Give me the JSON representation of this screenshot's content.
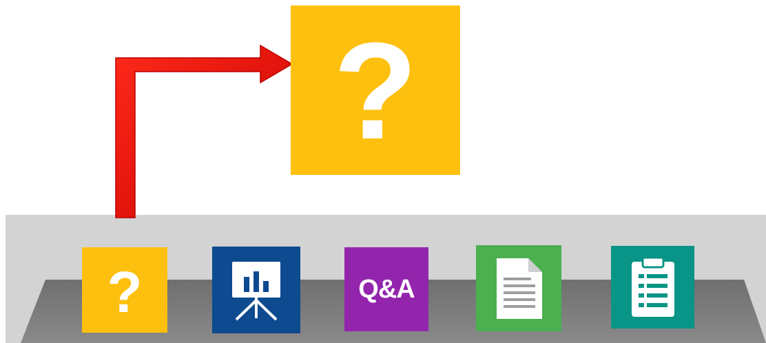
{
  "help_preview": {
    "glyph": "?",
    "color": "#fdc00f",
    "icon": "question-mark-icon"
  },
  "pointer": {
    "color": "#e60000",
    "icon": "arrow-pointer"
  },
  "toolbar": {
    "background": "#d3d3d3",
    "tray_color": "#7a7a7a",
    "items": [
      {
        "label": "?",
        "icon": "question-mark-icon",
        "color": "#fdc00f"
      },
      {
        "label": "",
        "icon": "presentation-board-icon",
        "color": "#0e4a8f"
      },
      {
        "label": "Q&A",
        "icon": "qa-icon",
        "color": "#9325ad"
      },
      {
        "label": "",
        "icon": "document-icon",
        "color": "#4caf50"
      },
      {
        "label": "",
        "icon": "clipboard-list-icon",
        "color": "#089486"
      }
    ]
  }
}
